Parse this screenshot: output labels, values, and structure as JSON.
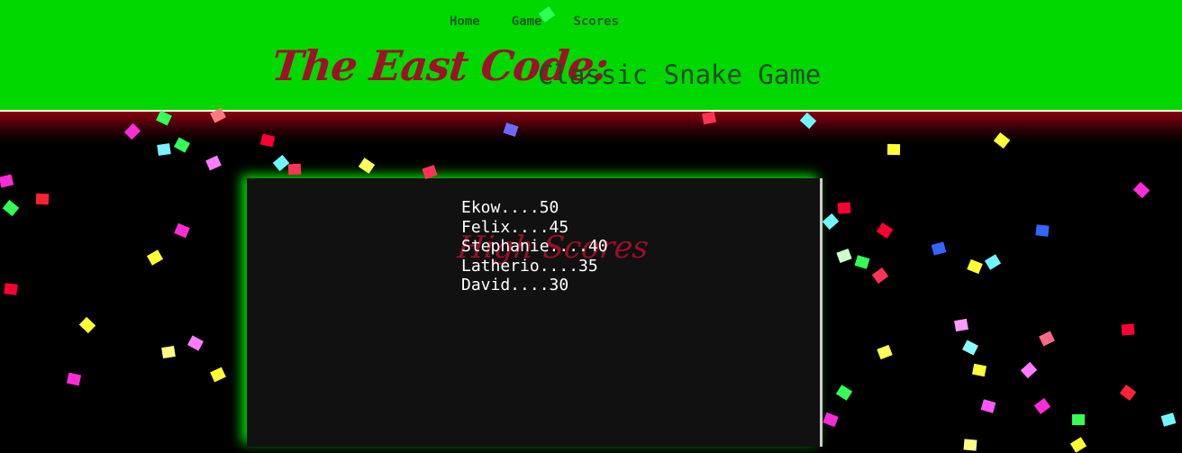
{
  "nav": {
    "items": [
      "Home",
      "Game",
      "Scores"
    ]
  },
  "header": {
    "brand": "The East Code:",
    "subtitle": "Classic Snake Game"
  },
  "scores": {
    "title": "High Scores",
    "entries": [
      "Ekow....50",
      "Felix....45",
      "Stephanie....40",
      "Latherio....35",
      "David....30"
    ]
  },
  "colors": {
    "header_bg": "#00d800",
    "brand": "#a0102a",
    "board_bg": "#111111"
  }
}
